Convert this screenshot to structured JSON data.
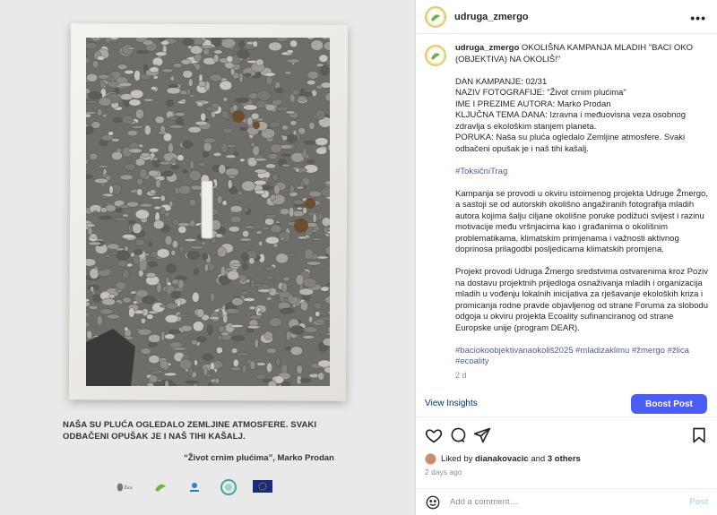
{
  "post_image": {
    "caption_text": "NAŠA SU PLUĆA OGLEDALO ZEMLJINE ATMOSFERE. SVAKI ODBAČENI OPUŠAK JE I NAŠ TIHI KAŠALJ.",
    "author_line": "“Život crnim plućima”, Marko Prodan",
    "logo_text": "Žica"
  },
  "header": {
    "username": "udruga_zmergo",
    "more_icon": "more-horizontal-icon"
  },
  "caption": {
    "username": "udruga_zmergo",
    "intro": "OKOLIŠNA KAMPANJA MLADIH \"BACI OKO (OBJEKTIVA) NA OKOLIŠ!\"",
    "details": "DAN KAMPANJE: 02/31\nNAZIV FOTOGRAFIJE: \"Život crnim plućima\"\nIME I PREZIME AUTORA: Marko Prodan\nKLJUČNA TEMA DANA: Izravna i međuovisna veza osobnog zdravlja s ekološkim stanjem planeta.\nPORUKA: Naša su pluća ogledalo Zemljine atmosfere. Svaki odbačeni opušak je i naš tihi kašalj.",
    "hashtag1": "#ToksičniTrag",
    "paragraph1": "Kampanja se provodi u okviru istoimenog projekta Udruge Žmergo, a sastoji se od autorskih okolišno angažiranih fotografija mladih autora kojima šalju ciljane okolišne poruke podižući svijest i razinu motivacije među vršnjacima kao i građanima o okolišnim problematikama, klimatskim primjenama i važnosti aktivnog doprinosa prilagodbi posljedicama klimatskih promjena.",
    "paragraph2": "Projekt provodi Udruga Žmergo sredstvima ostvarenima kroz Poziv na dostavu projektnih prijedloga osnaživanja mladih i organizacija mladih u vođenju lokalnih inicijativa za rješavanje ekoloških kriza i promicanja rodne pravde objavljenog od strane Foruma za slobodu odgoja u okviru projekta Ecoality sufinanciranog od strane Europske unije (program DEAR).",
    "hashtags": "#baciokoobjektivanaokoliš2025 #mladizaklimu #žmergo #žlica #ecoality",
    "time": "2 d"
  },
  "insights": {
    "view_label": "View Insights",
    "boost_label": "Boost Post"
  },
  "actions": {
    "like_icon": "heart-icon",
    "comment_icon": "comment-icon",
    "share_icon": "send-icon",
    "save_icon": "bookmark-icon"
  },
  "likes": {
    "prefix": "Liked by",
    "user": "dianakovacic",
    "middle": "and",
    "others": "3 others"
  },
  "timestamp": "2 days ago",
  "comment_box": {
    "placeholder": "Add a comment…",
    "post_label": "Post"
  },
  "colors": {
    "accent": "#4a5df9",
    "link": "#4a5da7",
    "muted": "#8e8e8e"
  }
}
